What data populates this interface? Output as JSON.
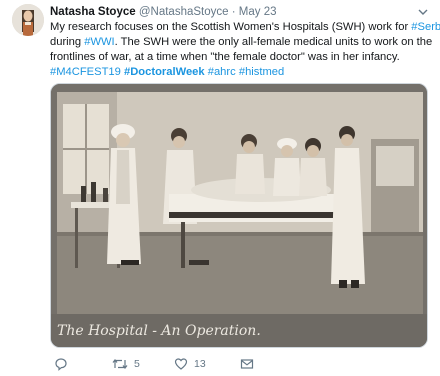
{
  "author": {
    "name": "Natasha Stoyce",
    "handle": "@NatashaStoyce",
    "separator": "·",
    "date": "May 23"
  },
  "tweet": {
    "line1": "My research focuses on the Scottish Women's Hospitals (SWH) work for ",
    "tag_serbia": "#Serbia",
    "line2": "during ",
    "tag_wwi": "#WWI",
    "line2_rest": ". The SWH were the only all-female medical units to work on the",
    "line3": "frontlines of war, at a time when \"the female doctor\" was in her infancy.",
    "tag_m4cfest": "#M4CFEST19",
    "tag_doctoral": "#DoctoralWeek",
    "tag_ahrc": "#ahrc",
    "tag_histmed": "#histmed"
  },
  "media": {
    "caption": "The Hospital - An Operation."
  },
  "actions": {
    "reply_count": "",
    "retweet_count": "5",
    "like_count": "13"
  },
  "colors": {
    "link": "#1b95e0",
    "muted": "#657786",
    "text": "#14171a"
  }
}
